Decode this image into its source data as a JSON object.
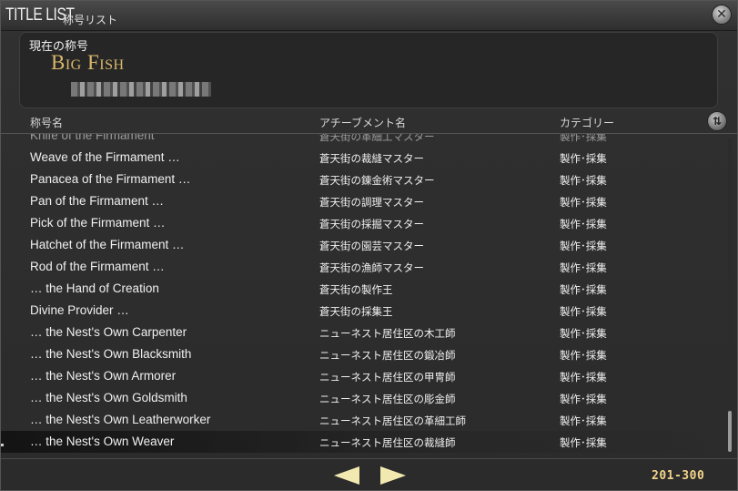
{
  "window": {
    "title": "TITLE LIST",
    "subtitle": "称号リスト",
    "close_icon": "close-icon"
  },
  "current": {
    "label": "現在の称号",
    "title": "Big Fish"
  },
  "columns": {
    "name": "称号名",
    "achievement": "アチーブメント名",
    "category": "カテゴリー"
  },
  "rows": [
    {
      "name": "Knife of the Firmament",
      "achievement": "蒼天街の革細工マスター",
      "category": "製作･採集"
    },
    {
      "name": "Weave of the Firmament …",
      "achievement": "蒼天街の裁縫マスター",
      "category": "製作･採集"
    },
    {
      "name": "Panacea of the Firmament …",
      "achievement": "蒼天街の錬金術マスター",
      "category": "製作･採集"
    },
    {
      "name": "Pan of the Firmament …",
      "achievement": "蒼天街の調理マスター",
      "category": "製作･採集"
    },
    {
      "name": "Pick of the Firmament …",
      "achievement": "蒼天街の採掘マスター",
      "category": "製作･採集"
    },
    {
      "name": "Hatchet of the Firmament …",
      "achievement": "蒼天街の園芸マスター",
      "category": "製作･採集"
    },
    {
      "name": "Rod of the Firmament …",
      "achievement": "蒼天街の漁師マスター",
      "category": "製作･採集"
    },
    {
      "name": "… the Hand of Creation",
      "achievement": "蒼天街の製作王",
      "category": "製作･採集"
    },
    {
      "name": "Divine Provider …",
      "achievement": "蒼天街の採集王",
      "category": "製作･採集"
    },
    {
      "name": "… the Nest's Own Carpenter",
      "achievement": "ニューネスト居住区の木工師",
      "category": "製作･採集"
    },
    {
      "name": "… the Nest's Own Blacksmith",
      "achievement": "ニューネスト居住区の鍛冶師",
      "category": "製作･採集"
    },
    {
      "name": "… the Nest's Own Armorer",
      "achievement": "ニューネスト居住区の甲冑師",
      "category": "製作･採集"
    },
    {
      "name": "… the Nest's Own Goldsmith",
      "achievement": "ニューネスト居住区の彫金師",
      "category": "製作･採集"
    },
    {
      "name": "… the Nest's Own Leatherworker",
      "achievement": "ニューネスト居住区の革細工師",
      "category": "製作･採集"
    },
    {
      "name": "… the Nest's Own Weaver",
      "achievement": "ニューネスト居住区の裁縫師",
      "category": "製作･採集"
    }
  ],
  "pager": {
    "range": "201-300",
    "prev_icon": "arrow-left-icon",
    "next_icon": "arrow-right-icon"
  },
  "colors": {
    "title_gold": "#d9b86a",
    "arrow": "#f2e9b0",
    "page_range": "#f3d48a"
  }
}
